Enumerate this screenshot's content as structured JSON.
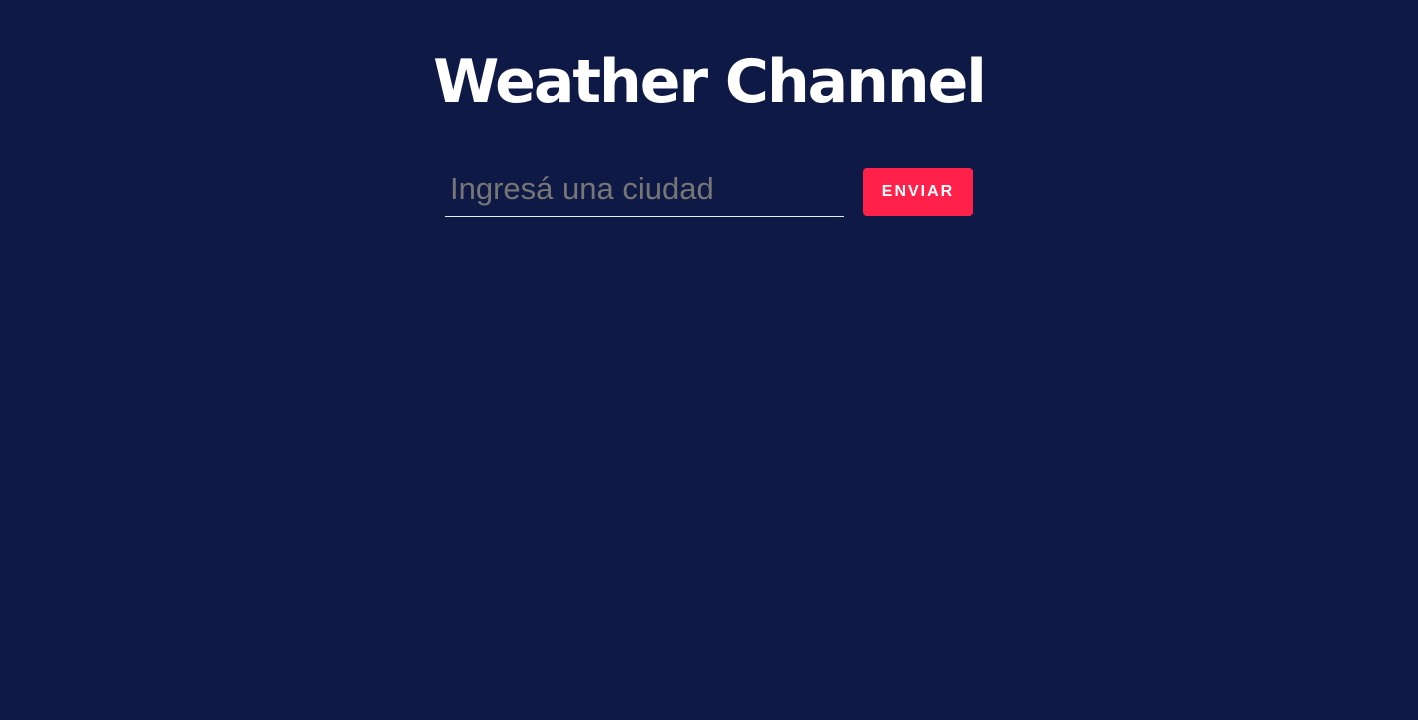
{
  "header": {
    "title": "Weather Channel"
  },
  "search": {
    "value": "",
    "placeholder": "Ingresá una ciudad",
    "submit_label": "ENVIAR"
  },
  "colors": {
    "background": "#0e1a45",
    "title": "#ffffff",
    "accent": "#ff2149",
    "placeholder": "#767676"
  }
}
